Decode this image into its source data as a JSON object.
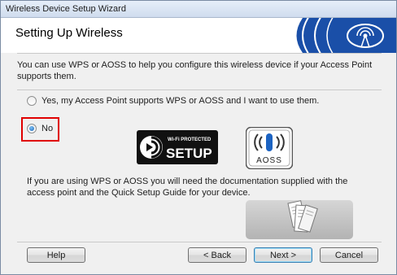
{
  "window": {
    "title": "Wireless Device Setup Wizard"
  },
  "banner": {
    "title": "Setting Up Wireless"
  },
  "intro_text": "You can use WPS or AOSS to help you configure this wireless device if your Access Point supports them.",
  "options": [
    {
      "label": "Yes, my Access Point supports WPS or AOSS and I want to use them.",
      "selected": false
    },
    {
      "label": "No",
      "selected": true
    }
  ],
  "logos": {
    "wps_top": "Wi-Fi PROTECTED",
    "wps_main": "SETUP",
    "aoss": "AOSS"
  },
  "note_text": "If you are using WPS or AOSS you will need the documentation supplied with the access point and the Quick Setup Guide for your device.",
  "buttons": {
    "help": "Help",
    "back": "< Back",
    "next": "Next >",
    "cancel": "Cancel"
  },
  "colors": {
    "highlight": "#e00000",
    "banner_blue": "#1a4fa8"
  }
}
